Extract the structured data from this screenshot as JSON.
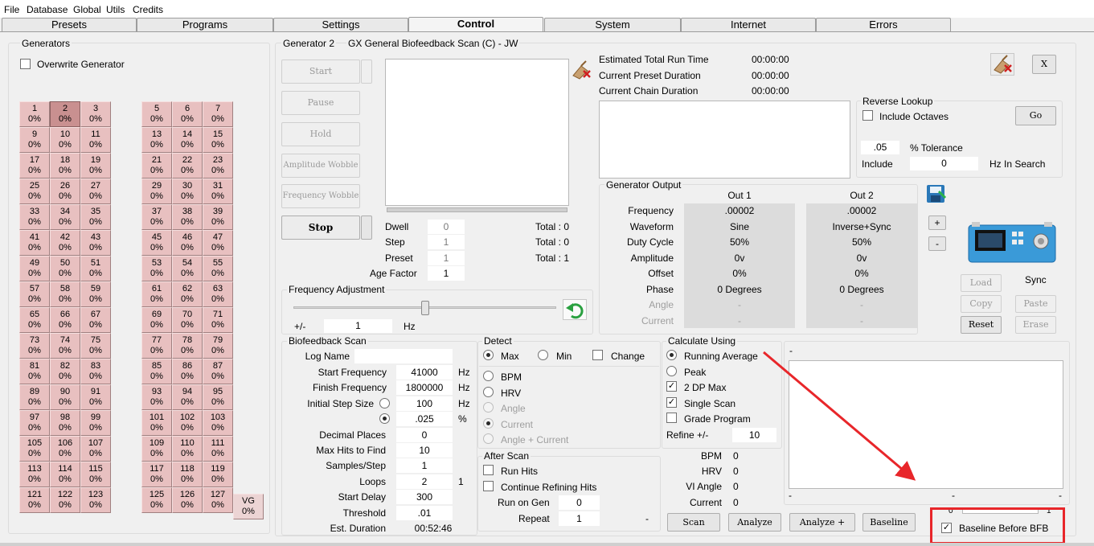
{
  "menu": [
    "File",
    "Database",
    "Global",
    "Utils",
    "Credits"
  ],
  "tabs": [
    "Presets",
    "Programs",
    "Settings",
    "Control",
    "System",
    "Internet",
    "Errors"
  ],
  "generators": {
    "title": "Generators",
    "overwrite_label": "Overwrite Generator",
    "left_cells": [
      [
        "1",
        "0%"
      ],
      [
        "2",
        "0%"
      ],
      [
        "3",
        "0%"
      ],
      [
        "9",
        "0%"
      ],
      [
        "10",
        "0%"
      ],
      [
        "11",
        "0%"
      ],
      [
        "17",
        "0%"
      ],
      [
        "18",
        "0%"
      ],
      [
        "19",
        "0%"
      ],
      [
        "25",
        "0%"
      ],
      [
        "26",
        "0%"
      ],
      [
        "27",
        "0%"
      ],
      [
        "33",
        "0%"
      ],
      [
        "34",
        "0%"
      ],
      [
        "35",
        "0%"
      ],
      [
        "41",
        "0%"
      ],
      [
        "42",
        "0%"
      ],
      [
        "43",
        "0%"
      ],
      [
        "49",
        "0%"
      ],
      [
        "50",
        "0%"
      ],
      [
        "51",
        "0%"
      ],
      [
        "57",
        "0%"
      ],
      [
        "58",
        "0%"
      ],
      [
        "59",
        "0%"
      ],
      [
        "65",
        "0%"
      ],
      [
        "66",
        "0%"
      ],
      [
        "67",
        "0%"
      ],
      [
        "73",
        "0%"
      ],
      [
        "74",
        "0%"
      ],
      [
        "75",
        "0%"
      ],
      [
        "81",
        "0%"
      ],
      [
        "82",
        "0%"
      ],
      [
        "83",
        "0%"
      ],
      [
        "89",
        "0%"
      ],
      [
        "90",
        "0%"
      ],
      [
        "91",
        "0%"
      ],
      [
        "97",
        "0%"
      ],
      [
        "98",
        "0%"
      ],
      [
        "99",
        "0%"
      ],
      [
        "105",
        "0%"
      ],
      [
        "106",
        "0%"
      ],
      [
        "107",
        "0%"
      ],
      [
        "113",
        "0%"
      ],
      [
        "114",
        "0%"
      ],
      [
        "115",
        "0%"
      ],
      [
        "121",
        "0%"
      ],
      [
        "122",
        "0%"
      ],
      [
        "123",
        "0%"
      ]
    ],
    "right_cells": [
      [
        "5",
        "0%"
      ],
      [
        "6",
        "0%"
      ],
      [
        "7",
        "0%"
      ],
      [
        "13",
        "0%"
      ],
      [
        "14",
        "0%"
      ],
      [
        "15",
        "0%"
      ],
      [
        "21",
        "0%"
      ],
      [
        "22",
        "0%"
      ],
      [
        "23",
        "0%"
      ],
      [
        "29",
        "0%"
      ],
      [
        "30",
        "0%"
      ],
      [
        "31",
        "0%"
      ],
      [
        "37",
        "0%"
      ],
      [
        "38",
        "0%"
      ],
      [
        "39",
        "0%"
      ],
      [
        "45",
        "0%"
      ],
      [
        "46",
        "0%"
      ],
      [
        "47",
        "0%"
      ],
      [
        "53",
        "0%"
      ],
      [
        "54",
        "0%"
      ],
      [
        "55",
        "0%"
      ],
      [
        "61",
        "0%"
      ],
      [
        "62",
        "0%"
      ],
      [
        "63",
        "0%"
      ],
      [
        "69",
        "0%"
      ],
      [
        "70",
        "0%"
      ],
      [
        "71",
        "0%"
      ],
      [
        "77",
        "0%"
      ],
      [
        "78",
        "0%"
      ],
      [
        "79",
        "0%"
      ],
      [
        "85",
        "0%"
      ],
      [
        "86",
        "0%"
      ],
      [
        "87",
        "0%"
      ],
      [
        "93",
        "0%"
      ],
      [
        "94",
        "0%"
      ],
      [
        "95",
        "0%"
      ],
      [
        "101",
        "0%"
      ],
      [
        "102",
        "0%"
      ],
      [
        "103",
        "0%"
      ],
      [
        "109",
        "0%"
      ],
      [
        "110",
        "0%"
      ],
      [
        "111",
        "0%"
      ],
      [
        "117",
        "0%"
      ],
      [
        "118",
        "0%"
      ],
      [
        "119",
        "0%"
      ],
      [
        "125",
        "0%"
      ],
      [
        "126",
        "0%"
      ],
      [
        "127",
        "0%"
      ]
    ],
    "vg_cell": [
      "VG",
      "0%"
    ]
  },
  "generator": {
    "title": "Generator 2",
    "preset_name": "GX General Biofeedback Scan (C) - JW",
    "buttons": {
      "start": "Start",
      "pause": "Pause",
      "hold": "Hold",
      "amp_wobble": "Amplitude Wobble",
      "freq_wobble": "Frequency Wobble",
      "stop": "Stop"
    },
    "dwell": {
      "label": "Dwell",
      "value": "0",
      "total": "Total : 0"
    },
    "step": {
      "label": "Step",
      "value": "1",
      "total": "Total : 0"
    },
    "preset": {
      "label": "Preset",
      "value": "1",
      "total": "Total : 1"
    },
    "age_factor": {
      "label": "Age Factor",
      "value": "1"
    }
  },
  "run": {
    "est_total_label": "Estimated Total Run Time",
    "est_total": "00:00:00",
    "preset_dur_label": "Current Preset Duration",
    "preset_dur": "00:00:00",
    "chain_dur_label": "Current Chain Duration",
    "chain_dur": "00:00:00"
  },
  "close_label": "X",
  "reverse_lookup": {
    "title": "Reverse Lookup",
    "include_octaves": "Include Octaves",
    "go": "Go",
    "tolerance_value": ".05",
    "tolerance_label": "% Tolerance",
    "include_label": "Include",
    "include_value": "0",
    "hz_search": "Hz In Search"
  },
  "gen_output": {
    "title": "Generator Output",
    "out1": "Out 1",
    "out2": "Out 2",
    "rows": [
      {
        "label": "Frequency",
        "o1": ".00002",
        "o2": ".00002",
        "disabled": false
      },
      {
        "label": "Waveform",
        "o1": "Sine",
        "o2": "Inverse+Sync",
        "disabled": false
      },
      {
        "label": "Duty Cycle",
        "o1": "50%",
        "o2": "50%",
        "disabled": false
      },
      {
        "label": "Amplitude",
        "o1": "0v",
        "o2": "0v",
        "disabled": false
      },
      {
        "label": "Offset",
        "o1": "0%",
        "o2": "0%",
        "disabled": false
      },
      {
        "label": "Phase",
        "o1": "0 Degrees",
        "o2": "0 Degrees",
        "disabled": false
      },
      {
        "label": "Angle",
        "o1": "-",
        "o2": "-",
        "disabled": true
      },
      {
        "label": "Current",
        "o1": "-",
        "o2": "-",
        "disabled": true
      }
    ],
    "plus": "+",
    "minus": "-"
  },
  "sync": {
    "label": "Sync",
    "load": "Load",
    "copy": "Copy",
    "paste": "Paste",
    "reset": "Reset",
    "erase": "Erase"
  },
  "freq_adj": {
    "title": "Frequency Adjustment",
    "pm": "+/-",
    "value": "1",
    "unit": "Hz",
    "slider": 0.5
  },
  "bfb": {
    "title": "Biofeedback Scan",
    "log_name": "Log Name",
    "start_freq": {
      "label": "Start Frequency",
      "value": "41000",
      "unit": "Hz"
    },
    "finish_freq": {
      "label": "Finish Frequency",
      "value": "1800000",
      "unit": "Hz"
    },
    "step_size": {
      "label": "Initial Step Size",
      "value": "100",
      "unit": "Hz"
    },
    "step_pct": {
      "value": ".025",
      "unit": "%"
    },
    "decimal": {
      "label": "Decimal Places",
      "value": "0"
    },
    "max_hits": {
      "label": "Max Hits to Find",
      "value": "10"
    },
    "samples": {
      "label": "Samples/Step",
      "value": "1"
    },
    "loops": {
      "label": "Loops",
      "value": "2",
      "extra": "1"
    },
    "start_delay": {
      "label": "Start Delay",
      "value": "300"
    },
    "threshold": {
      "label": "Threshold",
      "value": ".01"
    },
    "est_duration": {
      "label": "Est. Duration",
      "value": "00:52:46"
    }
  },
  "detect": {
    "title": "Detect",
    "max": "Max",
    "min": "Min",
    "change": "Change",
    "bpm": "BPM",
    "hrv": "HRV",
    "angle": "Angle",
    "current": "Current",
    "angle_current": "Angle + Current"
  },
  "after_scan": {
    "title": "After Scan",
    "run_hits": "Run Hits",
    "continue": "Continue Refining Hits",
    "run_on_gen": "Run on Gen",
    "run_on_gen_value": "0",
    "repeat": "Repeat",
    "repeat_value": "1",
    "dash": "-"
  },
  "calc": {
    "title": "Calculate Using",
    "running_avg": "Running Average",
    "peak": "Peak",
    "dp_max": "2 DP Max",
    "single_scan": "Single Scan",
    "grade": "Grade Program",
    "refine_label": "Refine +/-",
    "refine_value": "10"
  },
  "readouts": [
    {
      "label": "BPM",
      "value": "0"
    },
    {
      "label": "HRV",
      "value": "0"
    },
    {
      "label": "VI Angle",
      "value": "0"
    },
    {
      "label": "Current",
      "value": "0"
    }
  ],
  "bottom_buttons": {
    "scan": "Scan",
    "analyze": "Analyze",
    "analyze_plus": "Analyze +",
    "baseline": "Baseline"
  },
  "graph": {
    "dash_tl": "-",
    "dash_bl": "-",
    "dash_bm": "-",
    "dash_br": "-",
    "zero": "0",
    "one": "1"
  },
  "baseline_before_bfb": "Baseline Before BFB",
  "colors": {
    "annotation": "#e8262a",
    "cell": "#e8c0c0",
    "cell_selected": "#c99090"
  }
}
